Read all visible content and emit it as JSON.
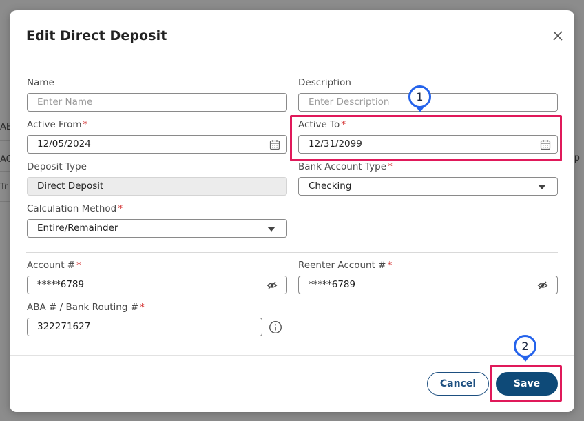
{
  "background": {
    "fragments": [
      "AE",
      "AC",
      "Tr",
      "p"
    ]
  },
  "modal": {
    "title": "Edit Direct Deposit",
    "close_icon": "close-icon"
  },
  "form": {
    "name": {
      "label": "Name",
      "placeholder": "Enter Name",
      "value": ""
    },
    "description": {
      "label": "Description",
      "placeholder": "Enter Description",
      "value": ""
    },
    "active_from": {
      "label": "Active From",
      "required": "*",
      "value": "12/05/2024",
      "icon": "calendar-icon"
    },
    "active_to": {
      "label": "Active To",
      "required": "*",
      "value": "12/31/2099",
      "icon": "calendar-icon"
    },
    "deposit_type": {
      "label": "Deposit Type",
      "value": "Direct Deposit"
    },
    "bank_account_type": {
      "label": "Bank Account Type",
      "required": "*",
      "value": "Checking"
    },
    "calculation_method": {
      "label": "Calculation Method",
      "required": "*",
      "value": "Entire/Remainder"
    },
    "account_number": {
      "label": "Account #",
      "required": "*",
      "value": "*****6789",
      "icon": "eye-slash-icon"
    },
    "reenter_account": {
      "label": "Reenter Account #",
      "required": "*",
      "value": "*****6789",
      "icon": "eye-slash-icon"
    },
    "routing": {
      "label": "ABA # / Bank Routing #",
      "required": "*",
      "value": "322271627",
      "icon": "info-icon"
    }
  },
  "footer": {
    "cancel_label": "Cancel",
    "save_label": "Save"
  },
  "annotations": {
    "callout_1": "1",
    "callout_2": "2",
    "highlight_color": "#e0195a",
    "callout_color": "#2563eb"
  },
  "colors": {
    "primary": "#0e4a78",
    "required": "#d32f2f"
  }
}
